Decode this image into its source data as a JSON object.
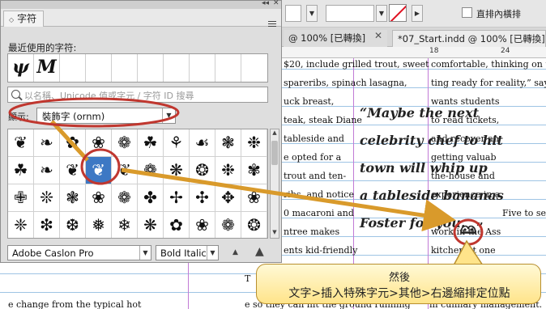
{
  "toolbar": {
    "checkbox_label": "直排內橫排",
    "stroke_color": "#e01020"
  },
  "tabs": [
    {
      "label": "@ 100% [已轉換]",
      "close": "✕"
    },
    {
      "label": "*07_Start.indd @ 100% [已轉換]",
      "close": "✕"
    }
  ],
  "ruler": {
    "numbers": [
      "18",
      "24"
    ]
  },
  "document": {
    "left_column": [
      "$20, include grilled trout, sweet",
      "spareribs, spinach lasagna,",
      "uck breast,",
      "teak, steak Diane",
      "tableside and",
      "e opted for a",
      "trout and ten-",
      "ribs, and notice",
      "0 macaroni and",
      "ntree makes",
      "ents kid-friendly",
      "al occasions."
    ],
    "right_column": [
      "comfortable, thinking on the",
      "ting ready for reality,” says Kl",
      "wants students",
      "to read tickets,",
      "and recover an",
      "getting valuab",
      "the-house and",
      "experience in a",
      "Five to sever",
      "work in the Ass",
      "kitchen at one",
      "Students at the"
    ],
    "pull_quote": [
      "“Maybe the next",
      "celebrity chef to hit",
      "town will whip up",
      "a tableside bananas",
      "Foster for you."
    ],
    "quote_close": "”",
    "bottom_left": "e change from the typical hot",
    "bottom_mid": "e so they can hit the ground running",
    "bottom_right": "in culinary management.",
    "bottom_T": "T"
  },
  "glyphs_panel": {
    "tab_label": "字符",
    "recent_label": "最近使用的字符:",
    "recent_glyphs": [
      "ψ",
      "M"
    ],
    "search_placeholder": "以名稱、Unicode 值或字元 / 字符 ID 搜尋",
    "show_label": "顯示:",
    "show_value": "裝飾字 (ornm)",
    "font_value": "Adobe Caslon Pro",
    "style_value": "Bold Italic",
    "zoom_out": "▲",
    "zoom_in": "▲"
  },
  "glyph_grid": [
    [
      "❦",
      "❧",
      "✿",
      "❀",
      "❁",
      "☘",
      "⚘",
      "☙",
      "❃",
      "❉"
    ],
    [
      "☘",
      "❧",
      "❦",
      "❀",
      "❦",
      "❁",
      "❋",
      "❂",
      "❉",
      "✾"
    ],
    [
      "✙",
      "❊",
      "❃",
      "❀",
      "❁",
      "✤",
      "✢",
      "✣",
      "✥",
      "❀"
    ],
    [
      "❈",
      "❇",
      "❆",
      "❅",
      "❄",
      "❋",
      "✿",
      "❀",
      "❁",
      "❂"
    ]
  ],
  "selected_glyph": "❦",
  "callout": {
    "line1": "然後",
    "line2": "文字>插入特殊字元>其他>右邊縮排定位點"
  },
  "colors": {
    "highlight": "#c0372f",
    "arrow": "#d99a2b",
    "selection": "#3d78c4"
  }
}
